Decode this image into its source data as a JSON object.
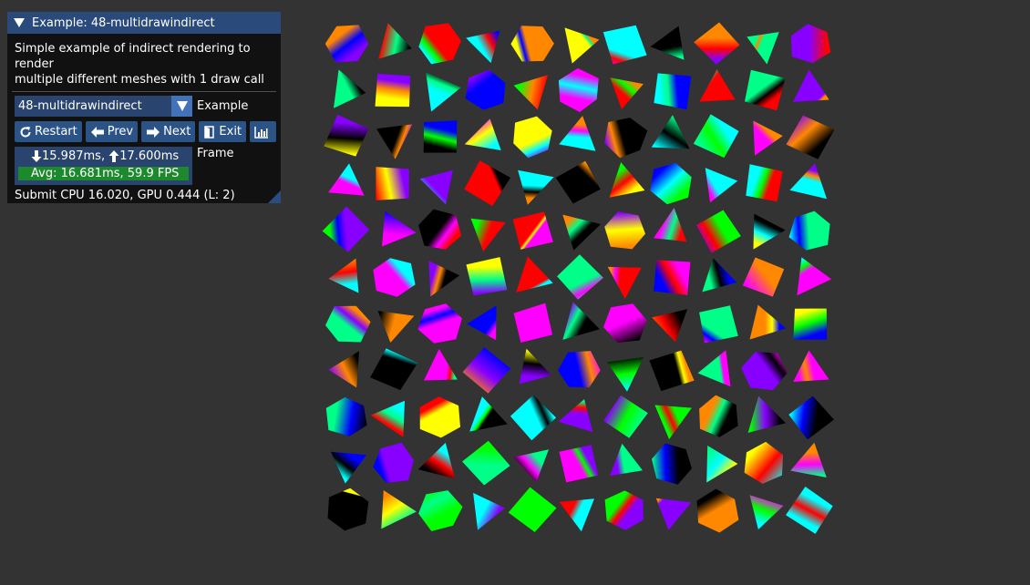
{
  "window": {
    "title": "Example: 48-multidrawindirect",
    "description_line1": "Simple example of indirect rendering to render",
    "description_line2": "multiple different meshes with 1 draw call"
  },
  "example_select": {
    "value": "48-multidrawindirect",
    "label": "Example"
  },
  "buttons": {
    "restart": "Restart",
    "prev": "Prev",
    "next": "Next",
    "exit": "Exit"
  },
  "frame": {
    "min": "15.987ms",
    "separator": ", ",
    "max": "17.600ms",
    "avg": "Avg: 16.681ms, 59.9 FPS",
    "label": "Frame"
  },
  "submit": {
    "text": "Submit CPU 16.020, GPU 0.444 (L: 2)"
  },
  "colors": {
    "background": "#333333",
    "title_bar": "#294a7a",
    "widget_bg": "#29446e",
    "button": "#2c5386",
    "fps_bar": "#1c8a2c"
  },
  "scene": {
    "grid_columns": 11,
    "grid_rows": 11,
    "mesh_kinds": [
      "cube",
      "pyramid"
    ]
  }
}
